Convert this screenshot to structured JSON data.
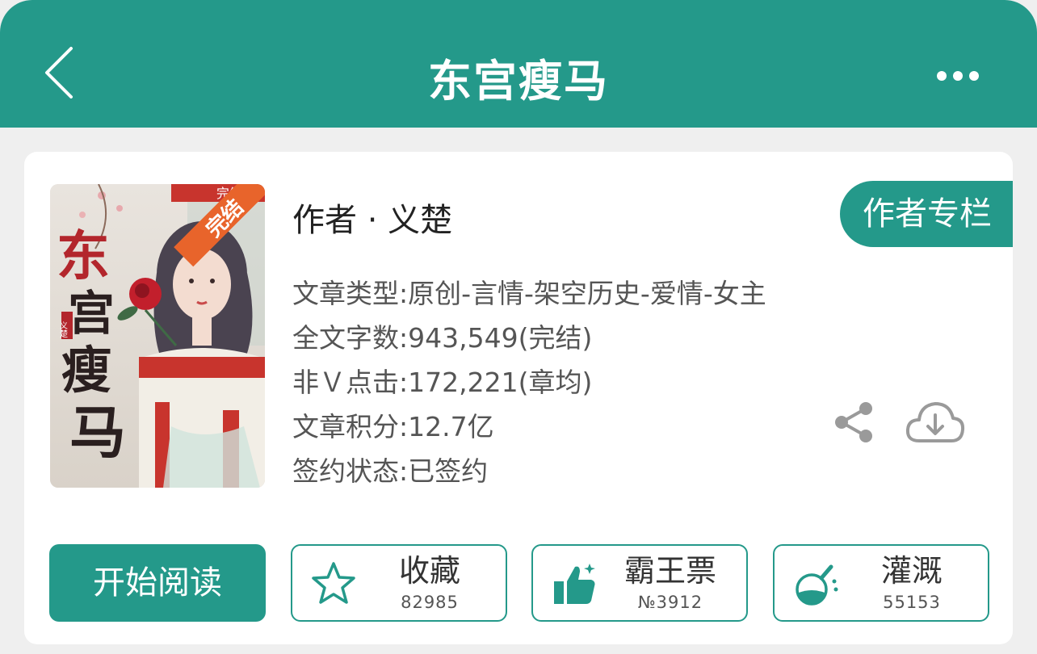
{
  "header": {
    "title": "东宫瘦马",
    "background": "#24998a"
  },
  "cover": {
    "badge": "完结",
    "badge_strip": "完结",
    "art_title_chars": [
      "东",
      "宫",
      "瘦",
      "马"
    ],
    "art_author": "义楚"
  },
  "book": {
    "author_line": "作者 · 义楚",
    "author_column_label": "作者专栏",
    "meta": {
      "type": "文章类型:原创-言情-架空历史-爱情-女主",
      "word_count": "全文字数:943,549(完结)",
      "clicks": "非Ｖ点击:172,221(章均)",
      "score": "文章积分:12.7亿",
      "contract": "签约状态:已签约"
    }
  },
  "actions": {
    "read_label": "开始阅读",
    "collect": {
      "label": "收藏",
      "count": "82985",
      "icon": "star-outline-icon"
    },
    "ticket": {
      "label": "霸王票",
      "count": "№3912",
      "icon": "thumbs-up-icon"
    },
    "water": {
      "label": "灌溉",
      "count": "55153",
      "icon": "flask-icon"
    }
  },
  "colors": {
    "accent": "#24998a",
    "icon_gray": "#9a9a9a",
    "badge": "#e8642b"
  }
}
